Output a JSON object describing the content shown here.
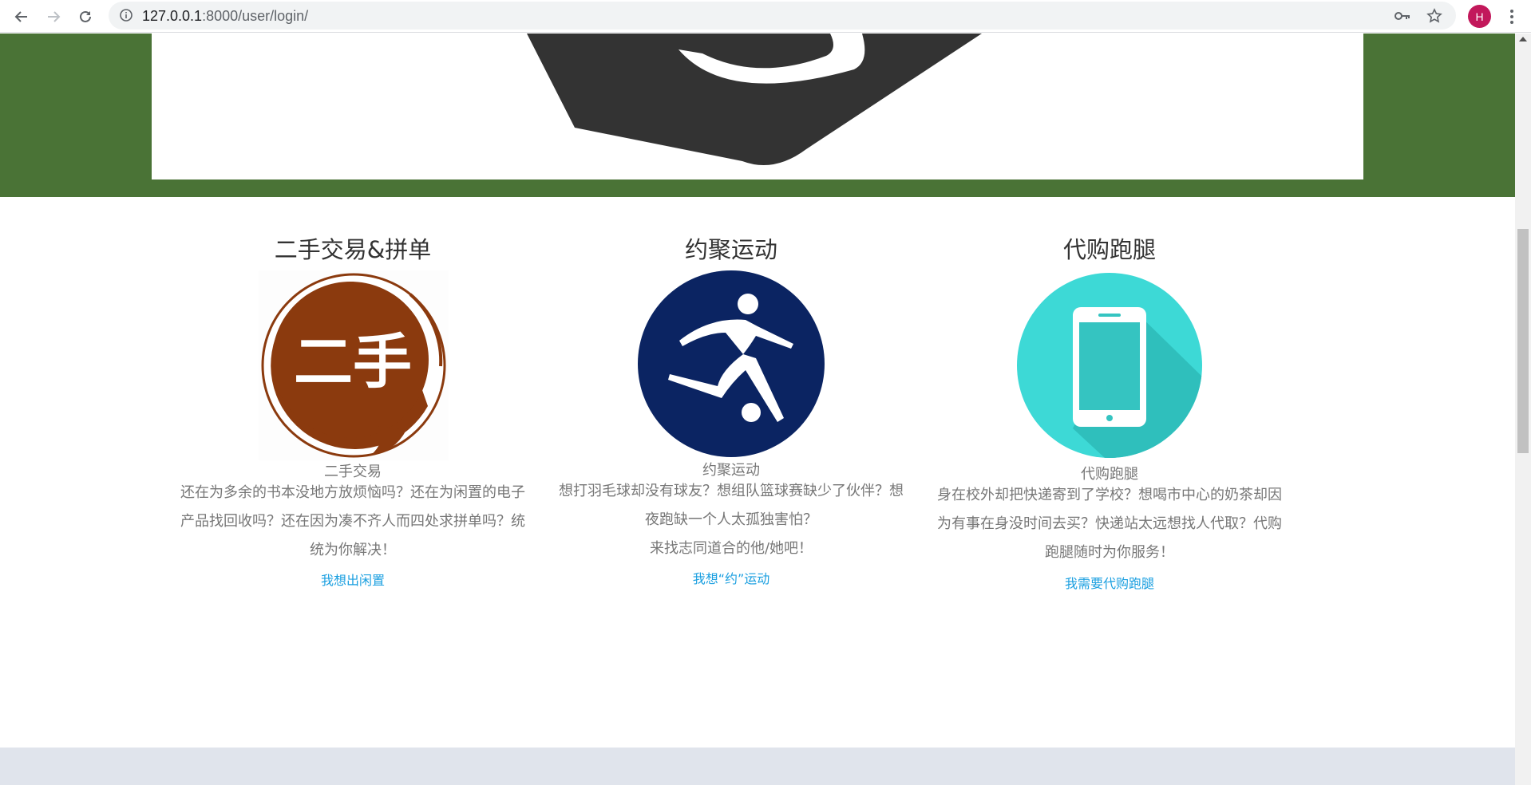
{
  "browser": {
    "url_host": "127.0.0.1",
    "url_rest": ":8000/user/login/",
    "profile_initial": "H"
  },
  "features": [
    {
      "title": "二手交易&拼单",
      "icon_text": "二手",
      "subtitle": "二手交易",
      "description": "还在为多余的书本没地方放烦恼吗？还在为闲置的电子产品找回收吗？还在因为凑不齐人而四处求拼单吗？统统为你解决！",
      "link": "我想出闲置"
    },
    {
      "title": "约聚运动",
      "subtitle": "约聚运动",
      "description_lines": [
        "想打羽毛球却没有球友？想组队篮球赛缺少了伙伴？想夜跑缺一个人太孤独害怕？",
        "来找志同道合的他/她吧！"
      ],
      "link": "我想“约”运动"
    },
    {
      "title": "代购跑腿",
      "subtitle": "代购跑腿",
      "description": "身在校外却把快递寄到了学校？想喝市中心的奶茶却因为有事在身没时间去买？快递站太远想找人代取？代购跑腿随时为你服务！",
      "link": "我需要代购跑腿"
    }
  ],
  "colors": {
    "hero_green": "#4a7336",
    "icon_brown": "#8b3a0e",
    "icon_navy": "#0b2462",
    "icon_teal": "#3dd9d6",
    "link_blue": "#1a9fe0"
  }
}
